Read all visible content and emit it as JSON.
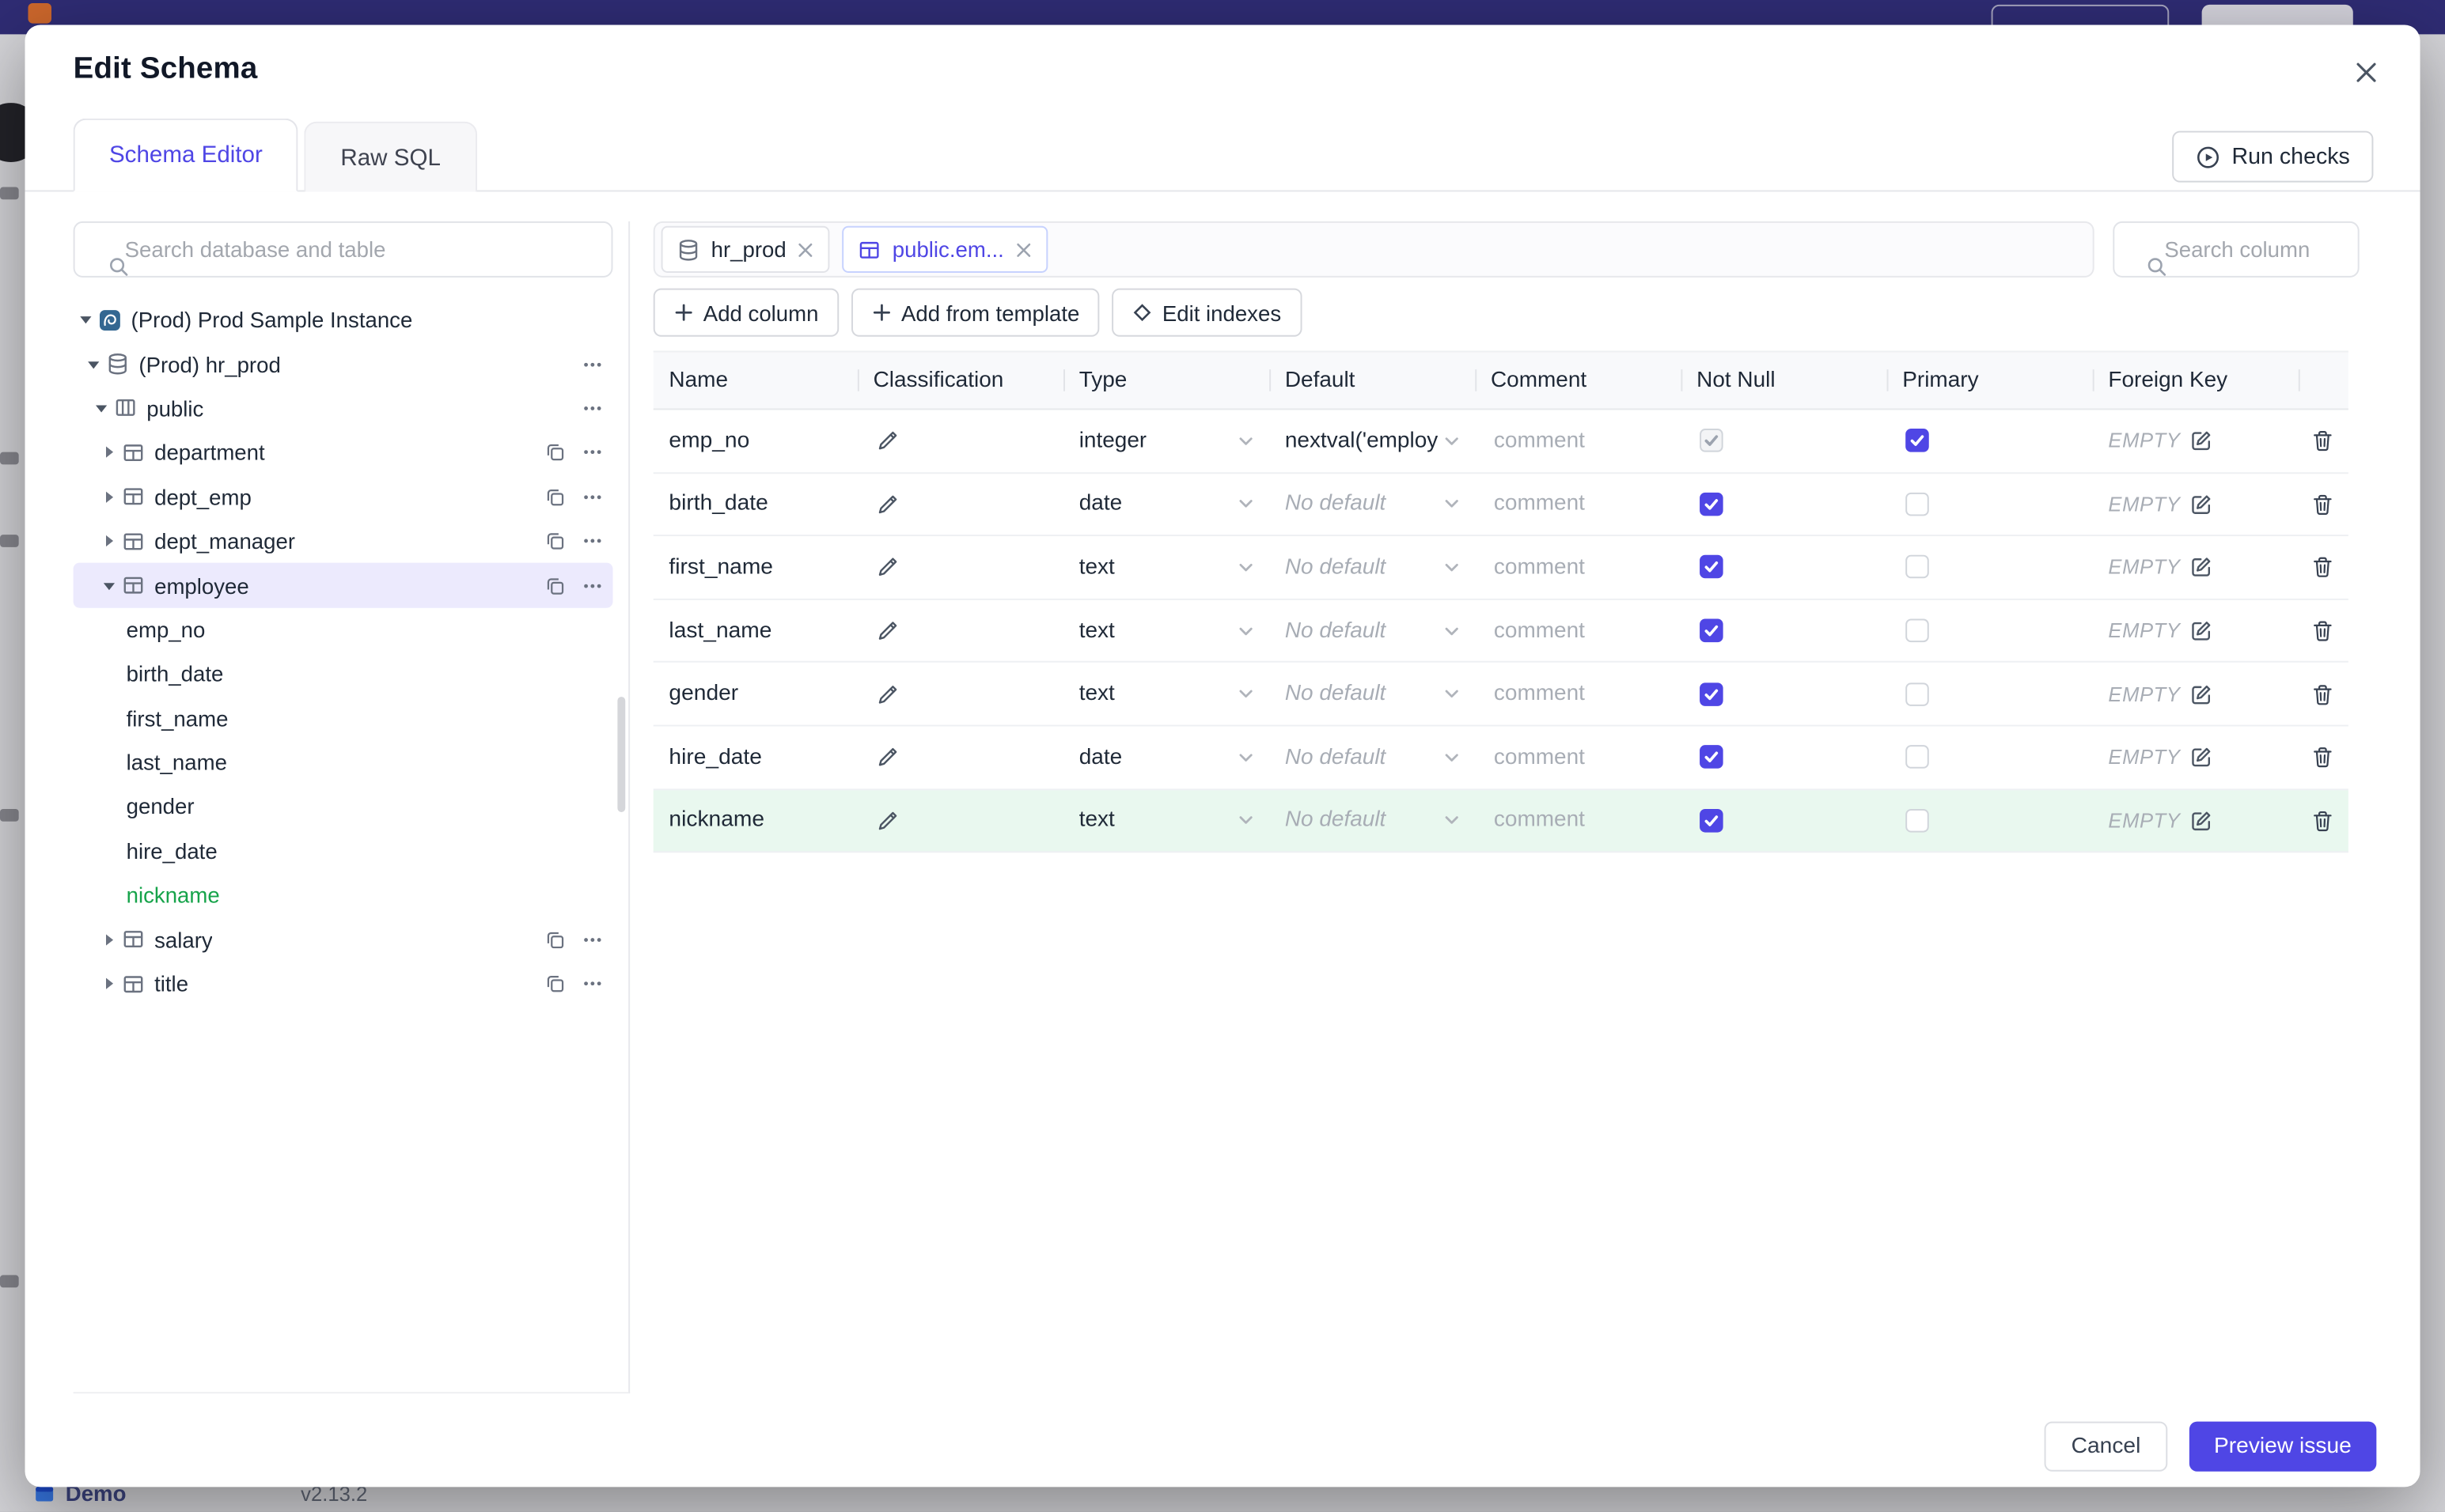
{
  "background": {
    "bottom_bar": {
      "demo_label": "Demo",
      "version": "v2.13.2"
    }
  },
  "modal": {
    "title": "Edit Schema",
    "tabs": [
      {
        "label": "Schema Editor",
        "active": true
      },
      {
        "label": "Raw SQL",
        "active": false
      }
    ],
    "run_checks_label": "Run checks",
    "tree": {
      "search_placeholder": "Search database and table",
      "items": [
        {
          "label": "(Prod) Prod Sample Instance",
          "level": 0,
          "icon": "instance",
          "expanded": true
        },
        {
          "label": "(Prod) hr_prod",
          "level": 1,
          "icon": "database",
          "expanded": true,
          "more": true
        },
        {
          "label": "public",
          "level": 2,
          "icon": "schema",
          "expanded": true,
          "more": true
        },
        {
          "label": "department",
          "level": 3,
          "icon": "table",
          "expanded": false,
          "copy": true,
          "more": true
        },
        {
          "label": "dept_emp",
          "level": 3,
          "icon": "table",
          "expanded": false,
          "copy": true,
          "more": true
        },
        {
          "label": "dept_manager",
          "level": 3,
          "icon": "table",
          "expanded": false,
          "copy": true,
          "more": true
        },
        {
          "label": "employee",
          "level": 3,
          "icon": "table",
          "expanded": true,
          "copy": true,
          "more": true,
          "selected": true
        },
        {
          "label": "emp_no",
          "kind": "column"
        },
        {
          "label": "birth_date",
          "kind": "column"
        },
        {
          "label": "first_name",
          "kind": "column"
        },
        {
          "label": "last_name",
          "kind": "column"
        },
        {
          "label": "gender",
          "kind": "column"
        },
        {
          "label": "hire_date",
          "kind": "column"
        },
        {
          "label": "nickname",
          "kind": "column",
          "state": "new"
        },
        {
          "label": "salary",
          "level": 3,
          "icon": "table",
          "expanded": false,
          "copy": true,
          "more": true
        },
        {
          "label": "title",
          "level": 3,
          "icon": "table",
          "expanded": false,
          "copy": true,
          "more": true
        }
      ]
    },
    "editor": {
      "tabs": [
        {
          "label": "hr_prod",
          "icon": "database",
          "active": false
        },
        {
          "label": "public.em...",
          "icon": "table",
          "active": true
        }
      ],
      "search_placeholder": "Search column",
      "actions": [
        {
          "label": "Add column",
          "icon": "plus"
        },
        {
          "label": "Add from template",
          "icon": "plus"
        },
        {
          "label": "Edit indexes",
          "icon": "diamond"
        }
      ],
      "table": {
        "headers": [
          "Name",
          "Classification",
          "Type",
          "Default",
          "Comment",
          "Not Null",
          "Primary",
          "Foreign Key",
          ""
        ],
        "comment_placeholder": "comment",
        "fk_value": "EMPTY",
        "rows": [
          {
            "name": "emp_no",
            "type": "integer",
            "default": "nextval('employ",
            "default_set": true,
            "not_null": true,
            "not_null_disabled": true,
            "primary": true,
            "highlight": false
          },
          {
            "name": "birth_date",
            "type": "date",
            "default": "No default",
            "default_set": false,
            "not_null": true,
            "not_null_disabled": false,
            "primary": false,
            "highlight": false
          },
          {
            "name": "first_name",
            "type": "text",
            "default": "No default",
            "default_set": false,
            "not_null": true,
            "not_null_disabled": false,
            "primary": false,
            "highlight": false
          },
          {
            "name": "last_name",
            "type": "text",
            "default": "No default",
            "default_set": false,
            "not_null": true,
            "not_null_disabled": false,
            "primary": false,
            "highlight": false
          },
          {
            "name": "gender",
            "type": "text",
            "default": "No default",
            "default_set": false,
            "not_null": true,
            "not_null_disabled": false,
            "primary": false,
            "highlight": false
          },
          {
            "name": "hire_date",
            "type": "date",
            "default": "No default",
            "default_set": false,
            "not_null": true,
            "not_null_disabled": false,
            "primary": false,
            "highlight": false
          },
          {
            "name": "nickname",
            "type": "text",
            "default": "No default",
            "default_set": false,
            "not_null": true,
            "not_null_disabled": false,
            "primary": false,
            "highlight": true
          }
        ]
      }
    },
    "footer": {
      "cancel_label": "Cancel",
      "submit_label": "Preview issue"
    }
  }
}
